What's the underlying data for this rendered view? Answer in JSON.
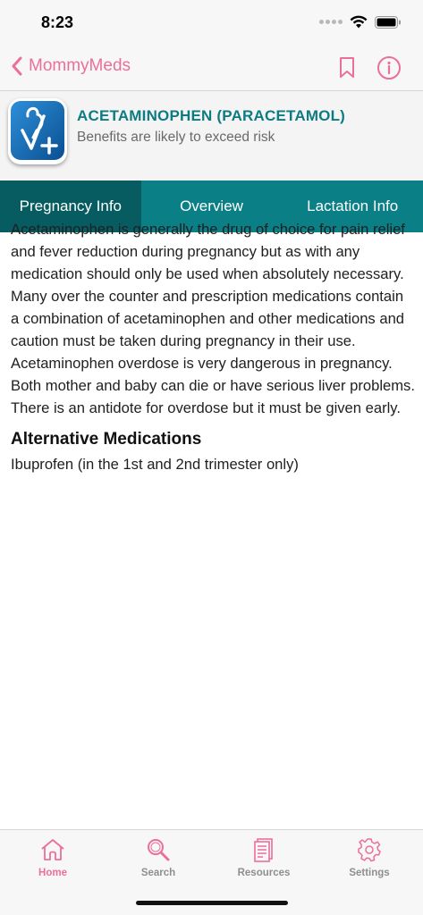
{
  "status_bar": {
    "time": "8:23"
  },
  "nav": {
    "back_label": "MommyMeds",
    "accent_color": "#ec6f9b"
  },
  "header": {
    "drug_name": "ACETAMINOPHEN (PARACETAMOL)",
    "risk_summary": "Benefits are likely to exceed risk",
    "title_color": "#0d7b82"
  },
  "tabs": [
    {
      "label": "Pregnancy Info",
      "active": true
    },
    {
      "label": "Overview",
      "active": false
    },
    {
      "label": "Lactation Info",
      "active": false
    }
  ],
  "content": {
    "body": "Acetaminophen is generally the drug of choice for pain relief and fever reduction during pregnancy but as with any medication should only be used when absolutely necessary. Many over the counter and prescription medications contain a combination of acetaminophen and other medications and caution must be taken during pregnancy in their use. Acetaminophen overdose is very dangerous in pregnancy. Both mother and baby can die or have serious liver problems. There is an antidote for overdose but it must be given early.",
    "alt_title": "Alternative Medications",
    "alt_body": "Ibuprofen (in the 1st and 2nd trimester only)"
  },
  "bottom_tabs": [
    {
      "label": "Home",
      "icon": "home-icon",
      "active": true
    },
    {
      "label": "Search",
      "icon": "search-icon",
      "active": false
    },
    {
      "label": "Resources",
      "icon": "resources-icon",
      "active": false
    },
    {
      "label": "Settings",
      "icon": "gear-icon",
      "active": false
    }
  ]
}
